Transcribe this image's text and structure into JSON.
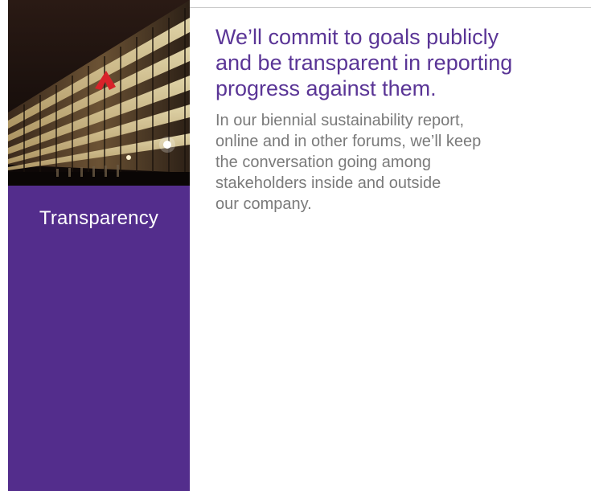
{
  "sidebar": {
    "label": "Transparency",
    "accent_color": "#532d8c",
    "photo": {
      "subject": "illuminated-office-building-at-night-icon"
    }
  },
  "main": {
    "headline": "We’ll commit to goals publicly\nand be transparent in reporting\nprogress against them.",
    "body": "In our biennial sustainability report,\nonline and in other forums, we’ll keep\nthe conversation going among\nstakeholders inside and outside\nour company.",
    "headline_color": "#5a3596",
    "body_color": "#7a7a7a"
  }
}
